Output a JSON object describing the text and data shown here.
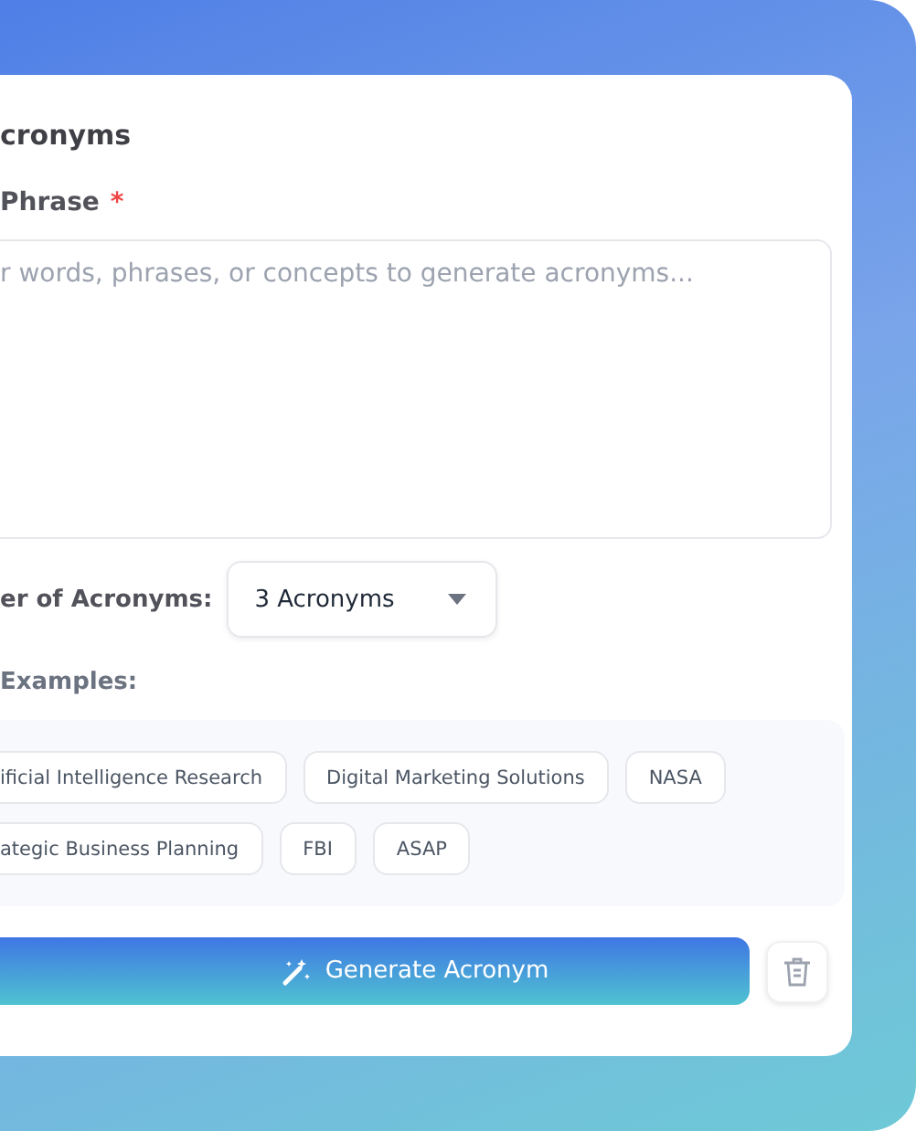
{
  "title": "cronyms",
  "phrase_field": {
    "label": "Phrase",
    "required_mark": "*",
    "placeholder": "r words, phrases, or concepts to generate acronyms..."
  },
  "count_field": {
    "label": "er of Acronyms:",
    "value": "3 Acronyms"
  },
  "examples_label": "Examples:",
  "examples": [
    [
      "ificial Intelligence Research",
      "Digital Marketing Solutions",
      "NASA"
    ],
    [
      "ategic Business Planning",
      "FBI",
      "ASAP"
    ]
  ],
  "generate_button": "Generate Acronym"
}
